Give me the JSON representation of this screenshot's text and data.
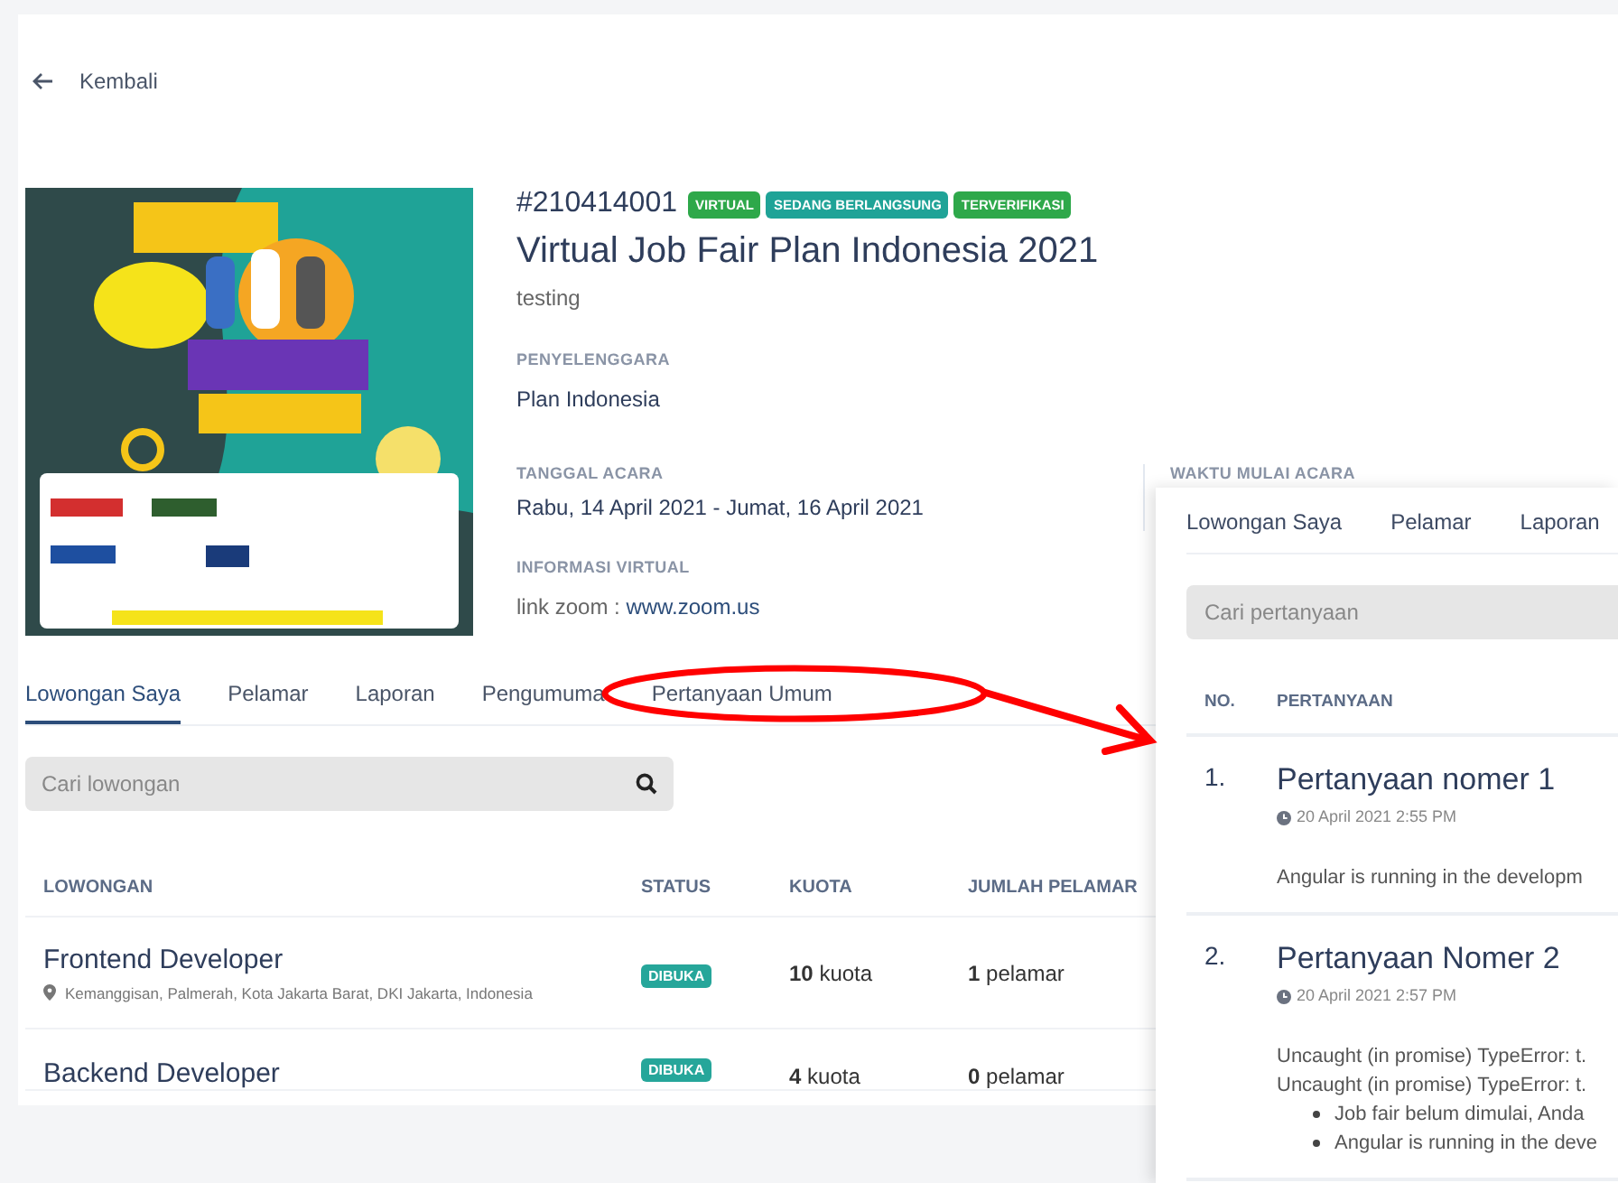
{
  "back_link": "Kembali",
  "event": {
    "id": "#210414001",
    "badges": [
      {
        "label": "VIRTUAL",
        "color": "#2ea84a"
      },
      {
        "label": "SEDANG BERLANGSUNG",
        "color": "#1fa397"
      },
      {
        "label": "TERVERIFIKASI",
        "color": "#2ea84a"
      }
    ],
    "title": "Virtual Job Fair Plan Indonesia 2021",
    "description": "testing",
    "organizer": {
      "label": "PENYELENGGARA",
      "value": "Plan Indonesia"
    },
    "date": {
      "label": "TANGGAL ACARA",
      "value": "Rabu, 14 April 2021 - Jumat, 16 April 2021"
    },
    "start_time": {
      "label": "WAKTU MULAI ACARA"
    },
    "virtual_info": {
      "label": "INFORMASI VIRTUAL",
      "prefix": "link zoom : ",
      "link": "www.zoom.us"
    }
  },
  "tabs": [
    {
      "label": "Lowongan Saya",
      "selected": true
    },
    {
      "label": "Pelamar",
      "selected": false
    },
    {
      "label": "Laporan",
      "selected": false
    },
    {
      "label": "Pengumuma",
      "selected": false
    },
    {
      "label": "Pertanyaan Umum",
      "selected": false
    }
  ],
  "search": {
    "placeholder": "Cari lowongan"
  },
  "table": {
    "columns": [
      "LOWONGAN",
      "STATUS",
      "KUOTA",
      "JUMLAH PELAMAR"
    ],
    "rows": [
      {
        "title": "Frontend Developer",
        "location": "Kemanggisan, Palmerah, Kota Jakarta Barat, DKI Jakarta, Indonesia",
        "status": "DIBUKA",
        "quota": "10",
        "quota_unit": "kuota",
        "applicants": "1",
        "applicants_unit": "pelamar"
      },
      {
        "title": "Backend Developer",
        "status": "DIBUKA",
        "quota": "4",
        "quota_unit": "kuota",
        "applicants": "0",
        "applicants_unit": "pelamar"
      }
    ]
  },
  "question_panel": {
    "tabs": [
      {
        "label": "Lowongan Saya",
        "selected": false
      },
      {
        "label": "Pelamar",
        "selected": false
      },
      {
        "label": "Laporan",
        "selected": false
      }
    ],
    "search": {
      "placeholder": "Cari pertanyaan"
    },
    "columns": [
      "NO.",
      "PERTANYAAN"
    ],
    "questions": [
      {
        "number": "1.",
        "title": "Pertanyaan nomer 1",
        "time": "20 April 2021 2:55 PM",
        "lines": [
          {
            "kind": "text",
            "text": "Angular is running in the developm"
          }
        ]
      },
      {
        "number": "2.",
        "title": "Pertanyaan Nomer 2",
        "time": "20 April 2021 2:57 PM",
        "lines": [
          {
            "kind": "text",
            "text": "Uncaught (in promise) TypeError: t."
          },
          {
            "kind": "text",
            "text": "Uncaught (in promise) TypeError: t."
          },
          {
            "kind": "bullet",
            "text": "Job fair belum dimulai, Anda"
          },
          {
            "kind": "bullet",
            "text": "Angular is running in the deve"
          }
        ]
      }
    ]
  }
}
